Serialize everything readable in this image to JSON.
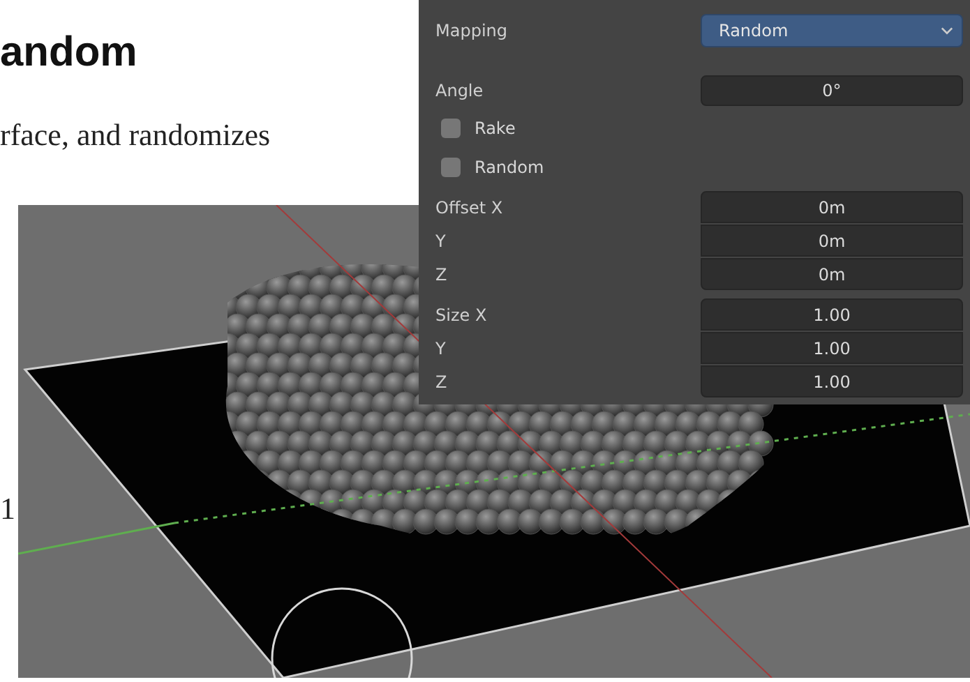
{
  "heading": "andom",
  "paragraph": "rface, and randomizes",
  "side_text": "1",
  "panel": {
    "rows": [
      {
        "kind": "dropdown",
        "label": "Mapping",
        "value": "Random"
      },
      {
        "kind": "number",
        "label": "Angle",
        "value": "0°"
      },
      {
        "kind": "checkbox",
        "label": "Rake",
        "checked": false
      },
      {
        "kind": "checkbox",
        "label": "Random",
        "checked": false
      },
      {
        "kind": "vector",
        "fields": [
          {
            "label": "Offset X",
            "value": "0m"
          },
          {
            "label": "Y",
            "value": "0m"
          },
          {
            "label": "Z",
            "value": "0m"
          }
        ]
      },
      {
        "kind": "vector",
        "fields": [
          {
            "label": "Size X",
            "value": "1.00"
          },
          {
            "label": "Y",
            "value": "1.00"
          },
          {
            "label": "Z",
            "value": "1.00"
          }
        ]
      }
    ]
  }
}
